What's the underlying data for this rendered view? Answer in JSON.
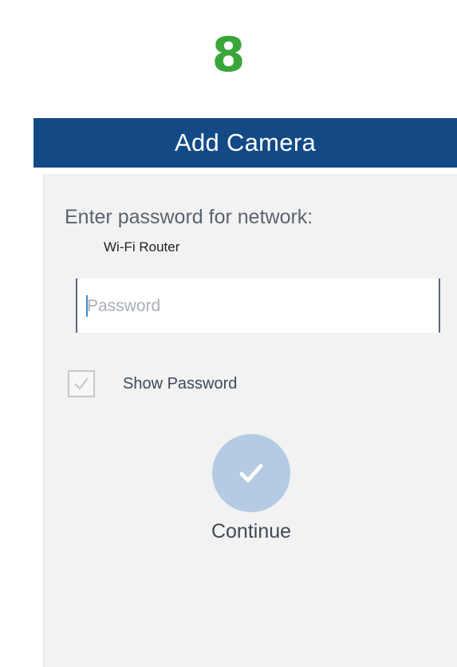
{
  "step": {
    "number": "8",
    "color": "#3aa63a"
  },
  "header": {
    "title": "Add Camera",
    "background": "#134a86"
  },
  "form": {
    "prompt": "Enter password for network:",
    "network_name": "Wi-Fi Router",
    "password": {
      "value": "",
      "placeholder": "Password"
    },
    "show_password": {
      "label": "Show Password",
      "checked": true
    }
  },
  "actions": {
    "continue_label": "Continue",
    "continue_icon": "checkmark-icon",
    "continue_color": "#b4cbe3"
  }
}
